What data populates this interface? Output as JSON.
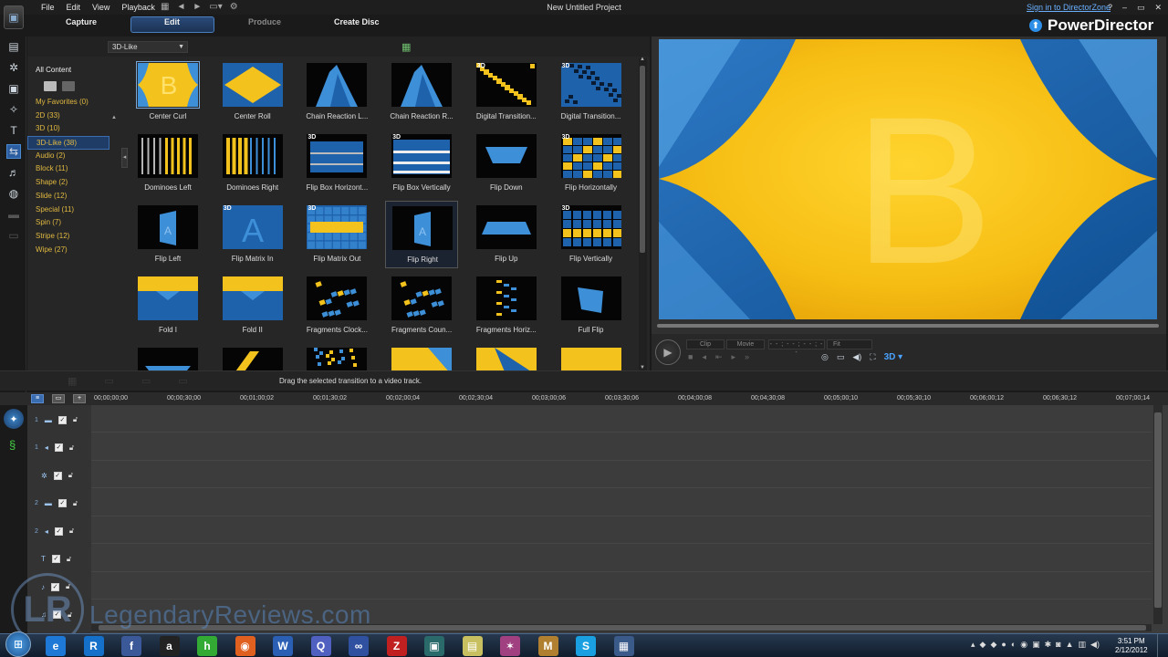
{
  "window": {
    "title": "New Untitled Project",
    "signin": "Sign in to DirectorZone",
    "brand": "PowerDirector",
    "controls": [
      "?",
      "–",
      "▭",
      "✕"
    ]
  },
  "menu": [
    "File",
    "Edit",
    "View",
    "Playback"
  ],
  "modes": {
    "capture": "Capture",
    "edit": "Edit",
    "produce": "Produce",
    "create_disc": "Create Disc"
  },
  "library": {
    "filter": "3D-Like",
    "all_content": "All Content",
    "categories": [
      {
        "label": "My Favorites  (0)"
      },
      {
        "label": "2D  (33)"
      },
      {
        "label": "3D  (10)"
      },
      {
        "label": "3D-Like  (38)",
        "selected": true
      },
      {
        "label": "Audio  (2)"
      },
      {
        "label": "Block  (11)"
      },
      {
        "label": "Shape  (2)"
      },
      {
        "label": "Slide  (12)"
      },
      {
        "label": "Special  (11)"
      },
      {
        "label": "Spin  (7)"
      },
      {
        "label": "Stripe  (12)"
      },
      {
        "label": "Wipe  (27)"
      }
    ],
    "transitions": [
      {
        "label": "Center Curl",
        "style": "curl",
        "selected": true
      },
      {
        "label": "Center Roll",
        "style": "roll"
      },
      {
        "label": "Chain Reaction L...",
        "style": "chainl"
      },
      {
        "label": "Chain Reaction R...",
        "style": "chainr"
      },
      {
        "label": "Digital Transition...",
        "style": "digital",
        "is3d": true
      },
      {
        "label": "Digital Transition...",
        "style": "digital2",
        "is3d": true
      },
      {
        "label": "Dominoes Left",
        "style": "domleft"
      },
      {
        "label": "Dominoes Right",
        "style": "domright"
      },
      {
        "label": "Flip Box Horizont...",
        "style": "fliph",
        "is3d": true
      },
      {
        "label": "Flip Box Vertically",
        "style": "flipv",
        "is3d": true
      },
      {
        "label": "Flip Down",
        "style": "flipdown"
      },
      {
        "label": "Flip Horizontally",
        "style": "fliphoriz",
        "is3d": true
      },
      {
        "label": "Flip Left",
        "style": "flipleft"
      },
      {
        "label": "Flip Matrix In",
        "style": "matrixin",
        "is3d": true
      },
      {
        "label": "Flip Matrix Out",
        "style": "matrixout",
        "is3d": true
      },
      {
        "label": "Flip Right",
        "style": "flipright",
        "highlight": true
      },
      {
        "label": "Flip Up",
        "style": "flipup"
      },
      {
        "label": "Flip Vertically",
        "style": "flipvert",
        "is3d": true
      },
      {
        "label": "Fold I",
        "style": "fold1"
      },
      {
        "label": "Fold II",
        "style": "fold2"
      },
      {
        "label": "Fragments Clock...",
        "style": "frag"
      },
      {
        "label": "Fragments Coun...",
        "style": "frag"
      },
      {
        "label": "Fragments Horiz...",
        "style": "fragh"
      },
      {
        "label": "Full Flip",
        "style": "fullflip"
      },
      {
        "label": "",
        "style": "partial1"
      },
      {
        "label": "",
        "style": "partial2"
      },
      {
        "label": "",
        "style": "partial3"
      },
      {
        "label": "",
        "style": "partial4"
      },
      {
        "label": "",
        "style": "partial5"
      },
      {
        "label": "",
        "style": "partial6"
      }
    ]
  },
  "preview": {
    "letter": "B",
    "clip": "Clip",
    "movie": "Movie",
    "timecode": "- - ; - - ; - - ; - -",
    "fit": "Fit",
    "btn_3d": "3D"
  },
  "status": "Drag the selected transition to a video track.",
  "timeline": {
    "ticks": [
      "00;00;00;00",
      "00;00;30;00",
      "00;01;00;02",
      "00;01;30;02",
      "00;02;00;04",
      "00;02;30;04",
      "00;03;00;06",
      "00;03;30;06",
      "00;04;00;08",
      "00;04;30;08",
      "00;05;00;10",
      "00;05;30;10",
      "00;06;00;12",
      "00;06;30;12",
      "00;07;00;14"
    ],
    "tracks": [
      {
        "num": "1",
        "icon": "▬",
        "type": "video"
      },
      {
        "num": "1",
        "icon": "◂",
        "type": "audio"
      },
      {
        "num": "",
        "icon": "✲",
        "type": "fx"
      },
      {
        "num": "2",
        "icon": "▬",
        "type": "video"
      },
      {
        "num": "2",
        "icon": "◂",
        "type": "audio"
      },
      {
        "num": "",
        "icon": "T",
        "type": "title"
      },
      {
        "num": "",
        "icon": "♪",
        "type": "voice"
      },
      {
        "num": "",
        "icon": "♫",
        "type": "music"
      }
    ]
  },
  "watermark": "LegendaryReviews.com",
  "taskbar": {
    "time": "3:51 PM",
    "date": "2/12/2012",
    "apps": [
      {
        "glyph": "e",
        "color": "#1e78d6"
      },
      {
        "glyph": "R",
        "color": "#1470c8"
      },
      {
        "glyph": "f",
        "color": "#3b5998"
      },
      {
        "glyph": "a",
        "color": "#222"
      },
      {
        "glyph": "h",
        "color": "#3a3"
      },
      {
        "glyph": "◉",
        "color": "#e06020"
      },
      {
        "glyph": "W",
        "color": "#2b5fb4"
      },
      {
        "glyph": "Q",
        "color": "#5060c0"
      },
      {
        "glyph": "∞",
        "color": "#3050a0"
      },
      {
        "glyph": "Z",
        "color": "#c02020"
      },
      {
        "glyph": "▣",
        "color": "#2a6a6a"
      },
      {
        "glyph": "▤",
        "color": "#c8c060"
      },
      {
        "glyph": "✶",
        "color": "#a04080"
      },
      {
        "glyph": "M",
        "color": "#b08030"
      },
      {
        "glyph": "S",
        "color": "#1aa0e0"
      },
      {
        "glyph": "▦",
        "color": "#3a5a8a"
      }
    ]
  }
}
